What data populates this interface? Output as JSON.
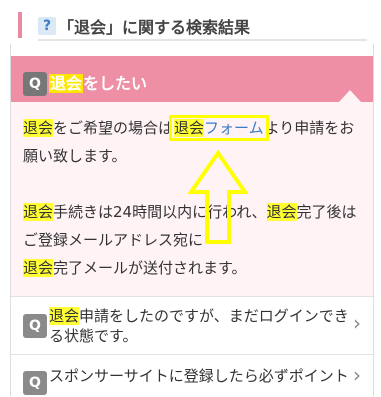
{
  "header": {
    "icon": "question-icon",
    "icon_glyph": "?",
    "title": "「退会」に関する検索結果"
  },
  "open_item": {
    "badge": "Q",
    "question": {
      "kw": "退会",
      "rest": "をしたい"
    },
    "answer": {
      "p1_line1": {
        "kw1": "退会",
        "t1": "をご希望の場合は",
        "kw2": "退会",
        "link": "フォーム",
        "t2": "より申請をお"
      },
      "p1_line2": "願い致します。",
      "p2_line1": {
        "kw1": "退会",
        "t1": "手続きは24時間以内に行われ、",
        "kw2": "退会",
        "t2": "完了後は"
      },
      "p2_line2": "ご登録メールアドレス宛に",
      "p2_line3": {
        "kw": "退会",
        "t": "完了メールが送付されます。"
      }
    }
  },
  "items": [
    {
      "badge": "Q",
      "kw": "退会",
      "line1": "申請をしたのですが、まだログインでき",
      "line2": "る状態です。",
      "chevron": "›"
    },
    {
      "badge": "Q",
      "line1": "スポンサーサイトに登録したら必ずポイント",
      "chevron": "›"
    }
  ],
  "colors": {
    "accent_pink": "#ee8fa6",
    "highlight": "#ffff33",
    "link": "#3a7cc4"
  }
}
